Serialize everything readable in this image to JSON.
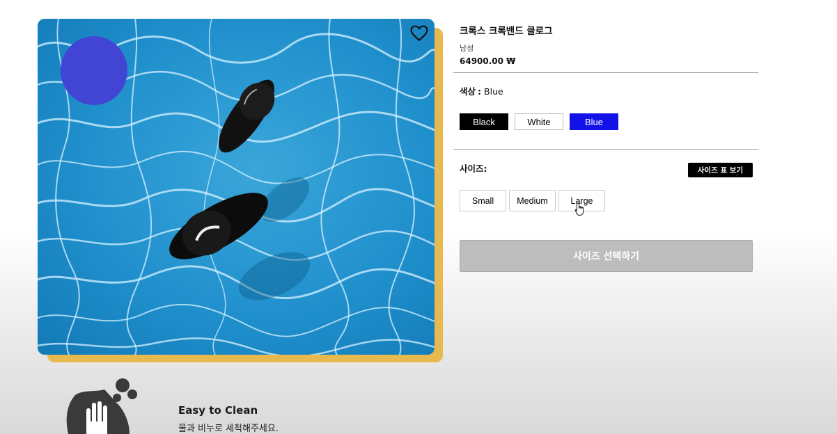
{
  "product": {
    "name": "크록스 크록밴드 클로그",
    "gender": "남성",
    "price": "64900.00 ₩"
  },
  "color": {
    "label": "색상",
    "selected": "Blue",
    "options": [
      "Black",
      "White",
      "Blue"
    ]
  },
  "size": {
    "label": "사이즈:",
    "chart_button": "사이즈 표 보기",
    "options": [
      "Small",
      "Medium",
      "Large"
    ]
  },
  "cta": {
    "label": "사이즈 선택하기"
  },
  "feature": {
    "title": "Easy to Clean",
    "description": "물과 비누로 세척해주세요."
  },
  "colors": {
    "accent_shadow": "#e8b94f",
    "dot": "#4244d4",
    "blue_swatch": "#1212e8",
    "cta_disabled": "#bdbdbd"
  },
  "icons": [
    "heart-icon",
    "hand-pointer-cursor-icon",
    "washing-hands-icon"
  ]
}
